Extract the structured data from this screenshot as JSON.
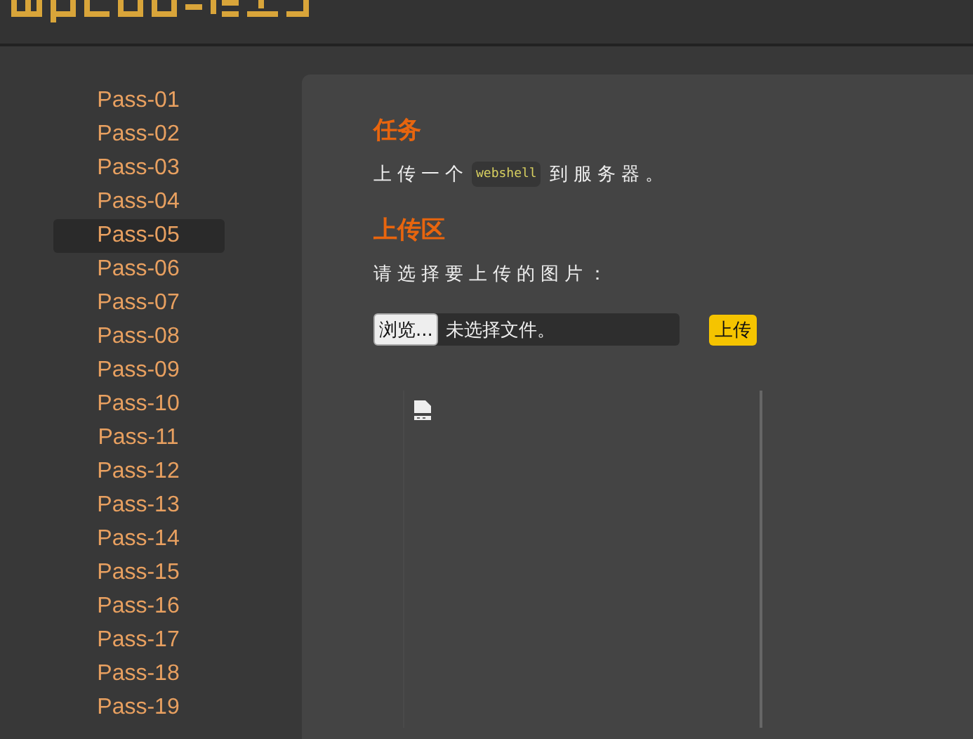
{
  "sidebar": {
    "items": [
      {
        "label": "Pass-01",
        "selected": false
      },
      {
        "label": "Pass-02",
        "selected": false
      },
      {
        "label": "Pass-03",
        "selected": false
      },
      {
        "label": "Pass-04",
        "selected": false
      },
      {
        "label": "Pass-05",
        "selected": true
      },
      {
        "label": "Pass-06",
        "selected": false
      },
      {
        "label": "Pass-07",
        "selected": false
      },
      {
        "label": "Pass-08",
        "selected": false
      },
      {
        "label": "Pass-09",
        "selected": false
      },
      {
        "label": "Pass-10",
        "selected": false
      },
      {
        "label": "Pass-11",
        "selected": false
      },
      {
        "label": "Pass-12",
        "selected": false
      },
      {
        "label": "Pass-13",
        "selected": false
      },
      {
        "label": "Pass-14",
        "selected": false
      },
      {
        "label": "Pass-15",
        "selected": false
      },
      {
        "label": "Pass-16",
        "selected": false
      },
      {
        "label": "Pass-17",
        "selected": false
      },
      {
        "label": "Pass-18",
        "selected": false
      },
      {
        "label": "Pass-19",
        "selected": false
      }
    ]
  },
  "task": {
    "heading": "任务",
    "text_before": "上传一个",
    "code": "webshell",
    "text_after": "到服务器。"
  },
  "upload": {
    "heading": "上传区",
    "prompt": "请选择要上传的图片：",
    "browse_button": "浏览...",
    "file_status": "未选择文件。",
    "submit_button": "上传"
  }
}
